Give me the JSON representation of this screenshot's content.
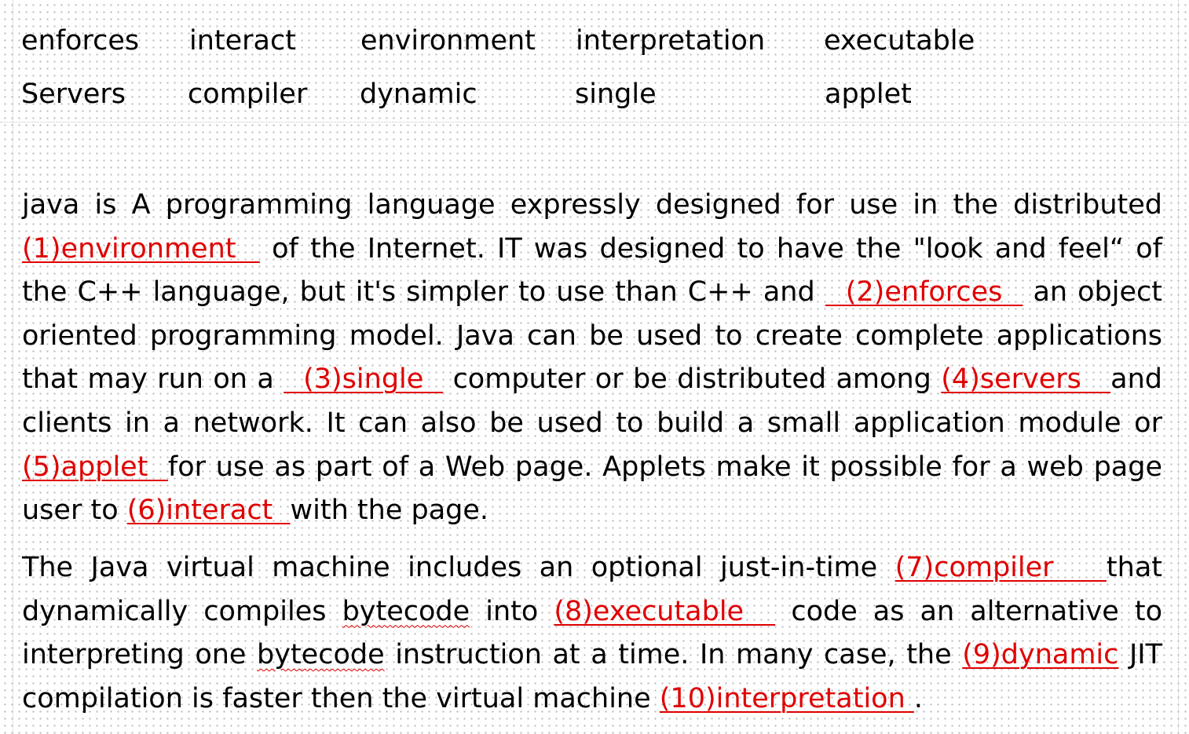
{
  "word_bank": {
    "row1": [
      "enforces",
      "interact",
      "environment",
      "interpretation",
      "executable"
    ],
    "row2": [
      "Servers",
      "compiler",
      "dynamic",
      "single",
      "applet"
    ]
  },
  "paragraph1": {
    "t0": "java is A programming language expressly designed for use in the distributed ",
    "b1": "(1)environment  ",
    "t1": " of the Internet. IT was designed to have the \"look and feel“ of the C++ language, but it's simpler to use than C++ and ",
    "b2": "  (2)enforces  ",
    "t2": " an object oriented programming model. Java can be used to create complete applications that may run on a ",
    "b3": "  (3)single  ",
    "t3": " computer or be distributed among ",
    "b4": "(4)servers   ",
    "t4": "and clients in a network. It can also be used to build a small application module or ",
    "b5": "(5)applet  ",
    "t5": "for use as part of a Web page. Applets make it possible for a web page user to ",
    "b6": "(6)interact  ",
    "t6": "with the page."
  },
  "paragraph2": {
    "t0": "The Java virtual machine includes an optional just-in-time ",
    "b7": "(7)compiler   ",
    "t1": "that dynamically compiles ",
    "w1": "bytecode",
    "t2": " into ",
    "b8": "(8)executable  ",
    "t3": " code as an alternative to interpreting one ",
    "w2": "bytecode",
    "t4": " instruction at a time. In many case, the ",
    "b9": "(9)dynamic",
    "t5": " JIT compilation is faster then the virtual machine ",
    "b10": "(10)interpretation ",
    "t6": "."
  },
  "colors": {
    "answer": "#e00000",
    "text": "#000000",
    "grid": "#c6c6c6"
  }
}
